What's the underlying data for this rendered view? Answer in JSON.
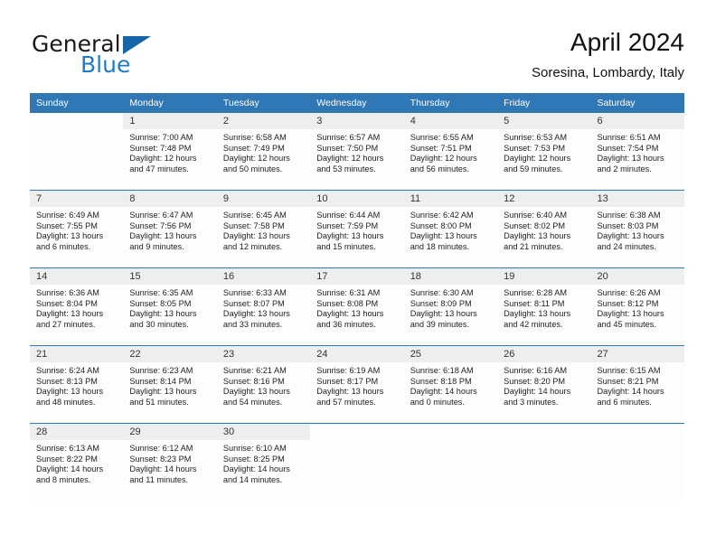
{
  "brand": {
    "name_part1": "General",
    "name_part2": "Blue",
    "logo_icon": "triangle-flag-icon",
    "color_dark": "#1a1a1a",
    "color_blue": "#1f7bc4"
  },
  "header": {
    "title": "April 2024",
    "subtitle": "Soresina, Lombardy, Italy"
  },
  "colors": {
    "header_row": "#3077b6",
    "daynum_band": "#eeeeee",
    "row_divider": "#3077b6",
    "cell_background": "#fdfdfd"
  },
  "weekday_headers": [
    "Sunday",
    "Monday",
    "Tuesday",
    "Wednesday",
    "Thursday",
    "Friday",
    "Saturday"
  ],
  "weeks": [
    [
      {
        "day": "",
        "sunrise": "",
        "sunset": "",
        "daylight_line1": "",
        "daylight_line2": ""
      },
      {
        "day": "1",
        "sunrise": "Sunrise: 7:00 AM",
        "sunset": "Sunset: 7:48 PM",
        "daylight_line1": "Daylight: 12 hours",
        "daylight_line2": "and 47 minutes."
      },
      {
        "day": "2",
        "sunrise": "Sunrise: 6:58 AM",
        "sunset": "Sunset: 7:49 PM",
        "daylight_line1": "Daylight: 12 hours",
        "daylight_line2": "and 50 minutes."
      },
      {
        "day": "3",
        "sunrise": "Sunrise: 6:57 AM",
        "sunset": "Sunset: 7:50 PM",
        "daylight_line1": "Daylight: 12 hours",
        "daylight_line2": "and 53 minutes."
      },
      {
        "day": "4",
        "sunrise": "Sunrise: 6:55 AM",
        "sunset": "Sunset: 7:51 PM",
        "daylight_line1": "Daylight: 12 hours",
        "daylight_line2": "and 56 minutes."
      },
      {
        "day": "5",
        "sunrise": "Sunrise: 6:53 AM",
        "sunset": "Sunset: 7:53 PM",
        "daylight_line1": "Daylight: 12 hours",
        "daylight_line2": "and 59 minutes."
      },
      {
        "day": "6",
        "sunrise": "Sunrise: 6:51 AM",
        "sunset": "Sunset: 7:54 PM",
        "daylight_line1": "Daylight: 13 hours",
        "daylight_line2": "and 2 minutes."
      }
    ],
    [
      {
        "day": "7",
        "sunrise": "Sunrise: 6:49 AM",
        "sunset": "Sunset: 7:55 PM",
        "daylight_line1": "Daylight: 13 hours",
        "daylight_line2": "and 6 minutes."
      },
      {
        "day": "8",
        "sunrise": "Sunrise: 6:47 AM",
        "sunset": "Sunset: 7:56 PM",
        "daylight_line1": "Daylight: 13 hours",
        "daylight_line2": "and 9 minutes."
      },
      {
        "day": "9",
        "sunrise": "Sunrise: 6:45 AM",
        "sunset": "Sunset: 7:58 PM",
        "daylight_line1": "Daylight: 13 hours",
        "daylight_line2": "and 12 minutes."
      },
      {
        "day": "10",
        "sunrise": "Sunrise: 6:44 AM",
        "sunset": "Sunset: 7:59 PM",
        "daylight_line1": "Daylight: 13 hours",
        "daylight_line2": "and 15 minutes."
      },
      {
        "day": "11",
        "sunrise": "Sunrise: 6:42 AM",
        "sunset": "Sunset: 8:00 PM",
        "daylight_line1": "Daylight: 13 hours",
        "daylight_line2": "and 18 minutes."
      },
      {
        "day": "12",
        "sunrise": "Sunrise: 6:40 AM",
        "sunset": "Sunset: 8:02 PM",
        "daylight_line1": "Daylight: 13 hours",
        "daylight_line2": "and 21 minutes."
      },
      {
        "day": "13",
        "sunrise": "Sunrise: 6:38 AM",
        "sunset": "Sunset: 8:03 PM",
        "daylight_line1": "Daylight: 13 hours",
        "daylight_line2": "and 24 minutes."
      }
    ],
    [
      {
        "day": "14",
        "sunrise": "Sunrise: 6:36 AM",
        "sunset": "Sunset: 8:04 PM",
        "daylight_line1": "Daylight: 13 hours",
        "daylight_line2": "and 27 minutes."
      },
      {
        "day": "15",
        "sunrise": "Sunrise: 6:35 AM",
        "sunset": "Sunset: 8:05 PM",
        "daylight_line1": "Daylight: 13 hours",
        "daylight_line2": "and 30 minutes."
      },
      {
        "day": "16",
        "sunrise": "Sunrise: 6:33 AM",
        "sunset": "Sunset: 8:07 PM",
        "daylight_line1": "Daylight: 13 hours",
        "daylight_line2": "and 33 minutes."
      },
      {
        "day": "17",
        "sunrise": "Sunrise: 6:31 AM",
        "sunset": "Sunset: 8:08 PM",
        "daylight_line1": "Daylight: 13 hours",
        "daylight_line2": "and 36 minutes."
      },
      {
        "day": "18",
        "sunrise": "Sunrise: 6:30 AM",
        "sunset": "Sunset: 8:09 PM",
        "daylight_line1": "Daylight: 13 hours",
        "daylight_line2": "and 39 minutes."
      },
      {
        "day": "19",
        "sunrise": "Sunrise: 6:28 AM",
        "sunset": "Sunset: 8:11 PM",
        "daylight_line1": "Daylight: 13 hours",
        "daylight_line2": "and 42 minutes."
      },
      {
        "day": "20",
        "sunrise": "Sunrise: 6:26 AM",
        "sunset": "Sunset: 8:12 PM",
        "daylight_line1": "Daylight: 13 hours",
        "daylight_line2": "and 45 minutes."
      }
    ],
    [
      {
        "day": "21",
        "sunrise": "Sunrise: 6:24 AM",
        "sunset": "Sunset: 8:13 PM",
        "daylight_line1": "Daylight: 13 hours",
        "daylight_line2": "and 48 minutes."
      },
      {
        "day": "22",
        "sunrise": "Sunrise: 6:23 AM",
        "sunset": "Sunset: 8:14 PM",
        "daylight_line1": "Daylight: 13 hours",
        "daylight_line2": "and 51 minutes."
      },
      {
        "day": "23",
        "sunrise": "Sunrise: 6:21 AM",
        "sunset": "Sunset: 8:16 PM",
        "daylight_line1": "Daylight: 13 hours",
        "daylight_line2": "and 54 minutes."
      },
      {
        "day": "24",
        "sunrise": "Sunrise: 6:19 AM",
        "sunset": "Sunset: 8:17 PM",
        "daylight_line1": "Daylight: 13 hours",
        "daylight_line2": "and 57 minutes."
      },
      {
        "day": "25",
        "sunrise": "Sunrise: 6:18 AM",
        "sunset": "Sunset: 8:18 PM",
        "daylight_line1": "Daylight: 14 hours",
        "daylight_line2": "and 0 minutes."
      },
      {
        "day": "26",
        "sunrise": "Sunrise: 6:16 AM",
        "sunset": "Sunset: 8:20 PM",
        "daylight_line1": "Daylight: 14 hours",
        "daylight_line2": "and 3 minutes."
      },
      {
        "day": "27",
        "sunrise": "Sunrise: 6:15 AM",
        "sunset": "Sunset: 8:21 PM",
        "daylight_line1": "Daylight: 14 hours",
        "daylight_line2": "and 6 minutes."
      }
    ],
    [
      {
        "day": "28",
        "sunrise": "Sunrise: 6:13 AM",
        "sunset": "Sunset: 8:22 PM",
        "daylight_line1": "Daylight: 14 hours",
        "daylight_line2": "and 8 minutes."
      },
      {
        "day": "29",
        "sunrise": "Sunrise: 6:12 AM",
        "sunset": "Sunset: 8:23 PM",
        "daylight_line1": "Daylight: 14 hours",
        "daylight_line2": "and 11 minutes."
      },
      {
        "day": "30",
        "sunrise": "Sunrise: 6:10 AM",
        "sunset": "Sunset: 8:25 PM",
        "daylight_line1": "Daylight: 14 hours",
        "daylight_line2": "and 14 minutes."
      },
      {
        "day": "",
        "sunrise": "",
        "sunset": "",
        "daylight_line1": "",
        "daylight_line2": ""
      },
      {
        "day": "",
        "sunrise": "",
        "sunset": "",
        "daylight_line1": "",
        "daylight_line2": ""
      },
      {
        "day": "",
        "sunrise": "",
        "sunset": "",
        "daylight_line1": "",
        "daylight_line2": ""
      },
      {
        "day": "",
        "sunrise": "",
        "sunset": "",
        "daylight_line1": "",
        "daylight_line2": ""
      }
    ]
  ]
}
